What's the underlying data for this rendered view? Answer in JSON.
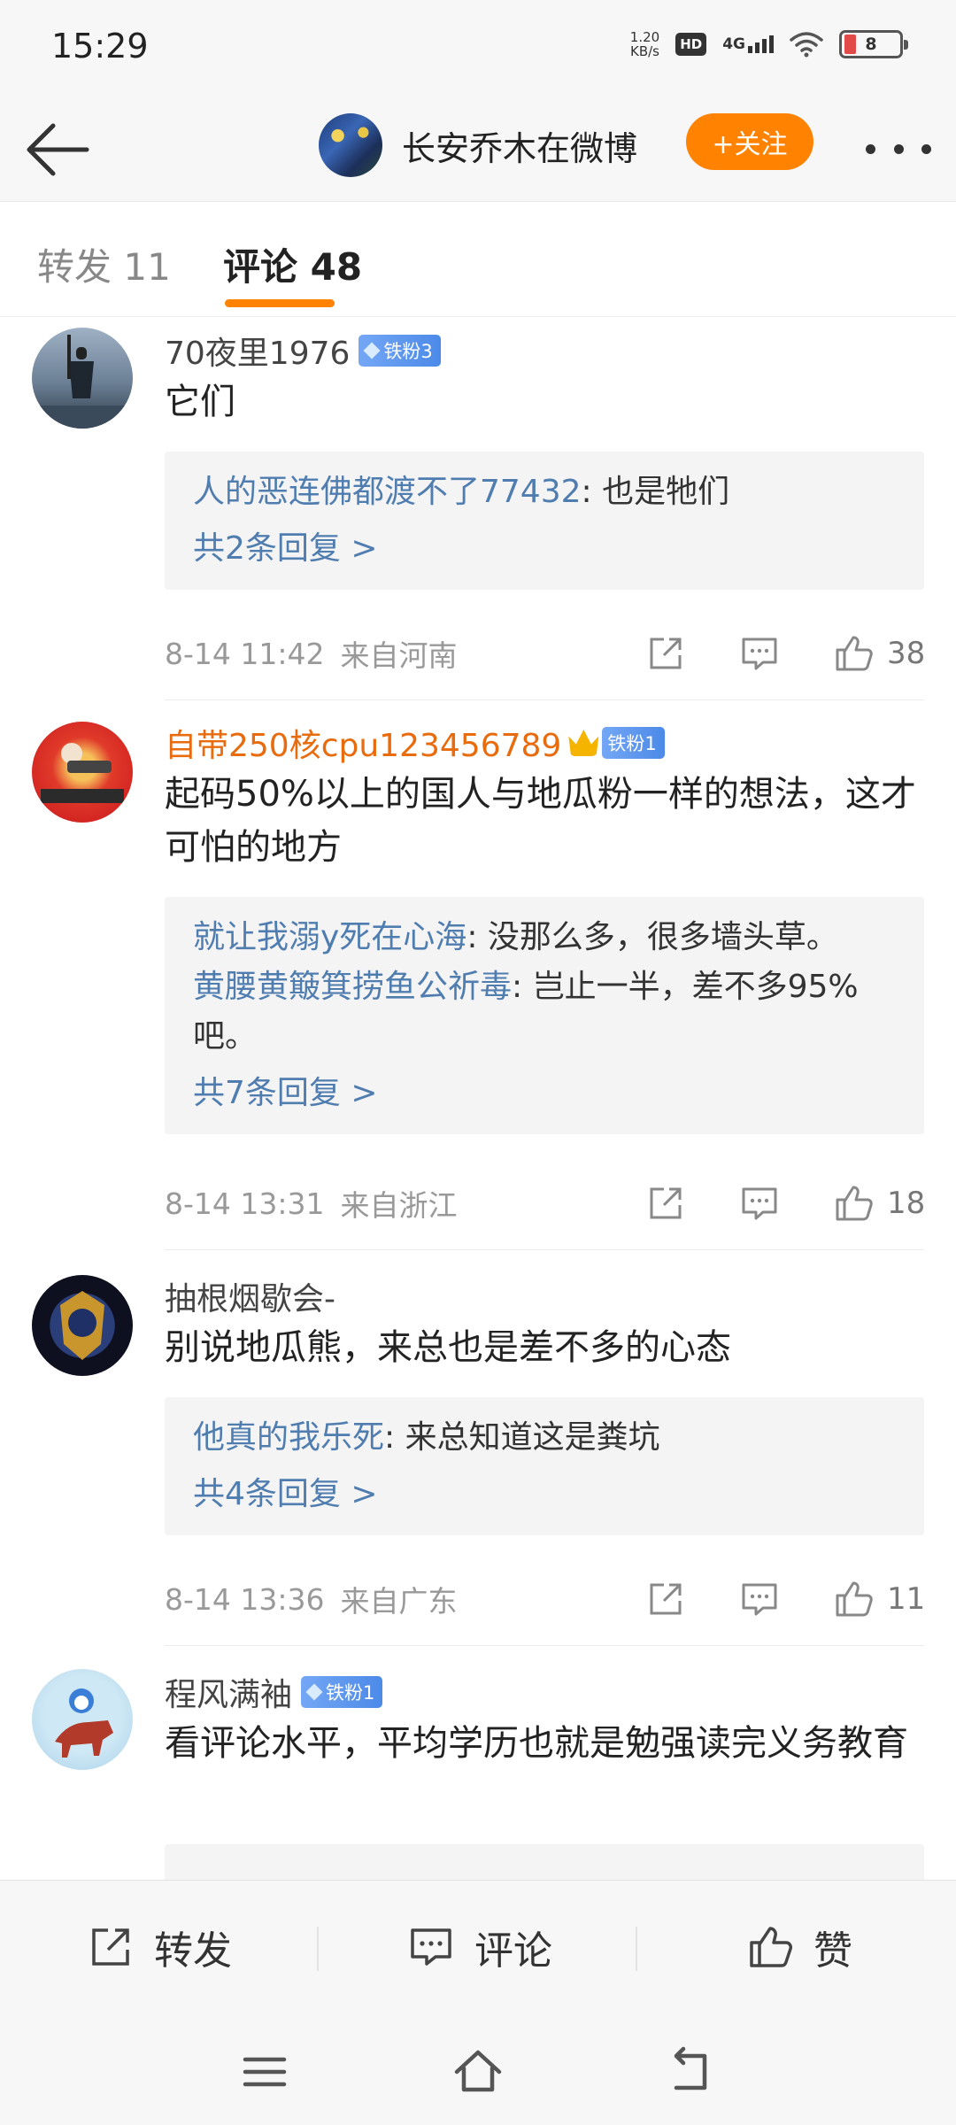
{
  "status_bar": {
    "time": "15:29",
    "net_speed_value": "1.20",
    "net_speed_unit": "KB/s",
    "hd": "HD",
    "network": "4G",
    "battery": "8"
  },
  "header": {
    "title": "长安乔木在微博",
    "follow_label": "+关注"
  },
  "tabs": {
    "repost": "转发 11",
    "comment": "评论 48"
  },
  "comments": [
    {
      "user": "70夜里1976",
      "badge": "铁粉3",
      "text": "它们",
      "replies": [
        {
          "user": "人的恶连佛都渡不了77432",
          "text": ": 也是牠们"
        }
      ],
      "more": "共2条回复 >",
      "time": "8-14 11:42",
      "location": "来自河南",
      "likes": "38"
    },
    {
      "user": "自带250核cpu123456789",
      "badge": "铁粉1",
      "text": "起码50%以上的国人与地瓜粉一样的想法，这才可怕的地方",
      "replies": [
        {
          "user": "就让我溺y死在心海",
          "text": ": 没那么多，很多墙头草。"
        },
        {
          "user": "黄腰黄簸箕捞鱼公祈毒",
          "text": ": 岂止一半，差不多95%吧。"
        }
      ],
      "more": "共7条回复 >",
      "time": "8-14 13:31",
      "location": "来自浙江",
      "likes": "18"
    },
    {
      "user": "抽根烟歇会-",
      "text": "别说地瓜熊，来总也是差不多的心态",
      "replies": [
        {
          "user": "他真的我乐死",
          "text": ": 来总知道这是粪坑"
        }
      ],
      "more": "共4条回复 >",
      "time": "8-14 13:36",
      "location": "来自广东",
      "likes": "11"
    },
    {
      "user": "程风满袖",
      "badge": "铁粉1",
      "text": "看评论水平，平均学历也就是勉强读完义务教育"
    }
  ],
  "bottom_bar": {
    "repost": "转发",
    "comment": "评论",
    "like": "赞"
  },
  "colors": {
    "accent": "#ff8200",
    "link": "#507daf",
    "vip_name": "#e86b0e",
    "badge": "#4c8ae8"
  }
}
